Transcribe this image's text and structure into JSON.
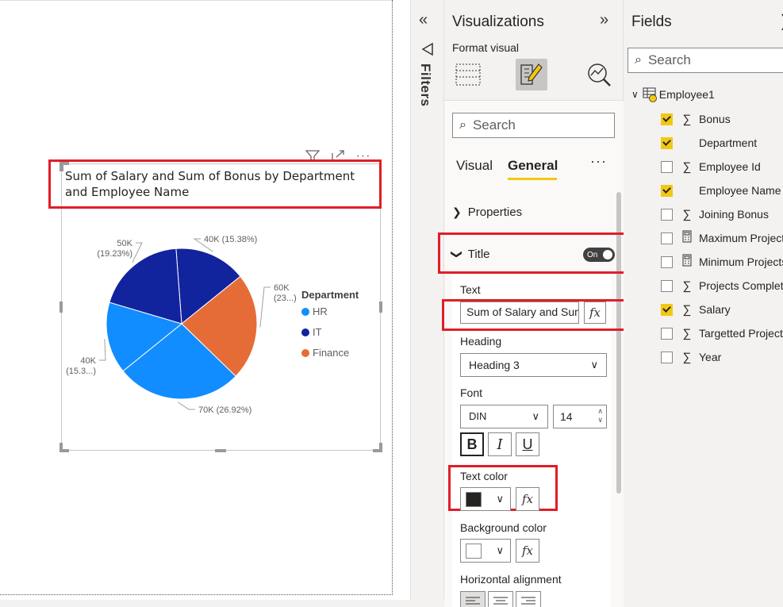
{
  "chart": {
    "title": "Sum of Salary and Sum of Bonus by Department and Employee Name",
    "legend_title": "Department",
    "legend": [
      {
        "label": "HR",
        "color": "#118dff"
      },
      {
        "label": "IT",
        "color": "#12239e"
      },
      {
        "label": "Finance",
        "color": "#e66c37"
      }
    ],
    "icons": [
      "filter-icon",
      "focus-mode-icon",
      "more-options-icon"
    ]
  },
  "chart_data": {
    "type": "pie",
    "title": "Sum of Salary and Sum of Bonus by Department and Employee Name",
    "legend_title": "Department",
    "legend_position": "right",
    "slices": [
      {
        "label": "40K (15.38%)",
        "value": 40000,
        "percent": 15.38,
        "department": "IT",
        "color": "#12239e"
      },
      {
        "label": "60K (23...)",
        "value": 60000,
        "percent": 23.08,
        "department": "Finance",
        "color": "#e66c37"
      },
      {
        "label": "70K (26.92%)",
        "value": 70000,
        "percent": 26.92,
        "department": "HR",
        "color": "#118dff"
      },
      {
        "label": "40K (15.3...)",
        "value": 40000,
        "percent": 15.38,
        "department": "HR",
        "color": "#118dff"
      },
      {
        "label": "50K (19.23%)",
        "value": 50000,
        "percent": 19.23,
        "department": "IT",
        "color": "#12239e"
      }
    ]
  },
  "filters": {
    "label": "Filters"
  },
  "visualizations": {
    "title": "Visualizations",
    "format_visual": "Format visual",
    "search_placeholder": "Search",
    "tabs": [
      "Visual",
      "General"
    ],
    "active_tab": "General",
    "more": "···",
    "properties_label": "Properties",
    "title_section": {
      "label": "Title",
      "toggle": "On",
      "text_label": "Text",
      "text_value": "Sum of Salary and Sum of Bonus by Department and Employee Name",
      "heading_label": "Heading",
      "heading_value": "Heading 3",
      "font_label": "Font",
      "font_value": "DIN",
      "font_size": "14",
      "bold": "B",
      "italic": "I",
      "underline": "U",
      "text_color_label": "Text color",
      "text_color": "#252423",
      "bg_color_label": "Background color",
      "bg_color": "#ffffff",
      "h_align_label": "Horizontal alignment"
    }
  },
  "fields": {
    "title": "Fields",
    "search_placeholder": "Search",
    "table": "Employee1",
    "items": [
      {
        "label": "Bonus",
        "checked": true,
        "type": "sum"
      },
      {
        "label": "Department",
        "checked": true,
        "type": "none"
      },
      {
        "label": "Employee Id",
        "checked": false,
        "type": "sum"
      },
      {
        "label": "Employee Name",
        "checked": true,
        "type": "none"
      },
      {
        "label": "Joining Bonus",
        "checked": false,
        "type": "sum"
      },
      {
        "label": "Maximum Projects",
        "checked": false,
        "type": "calc"
      },
      {
        "label": "Minimum Projects",
        "checked": false,
        "type": "calc"
      },
      {
        "label": "Projects Completed",
        "checked": false,
        "type": "sum"
      },
      {
        "label": "Salary",
        "checked": true,
        "type": "sum"
      },
      {
        "label": "Targetted Projects",
        "checked": false,
        "type": "sum"
      },
      {
        "label": "Year",
        "checked": false,
        "type": "sum"
      }
    ]
  }
}
